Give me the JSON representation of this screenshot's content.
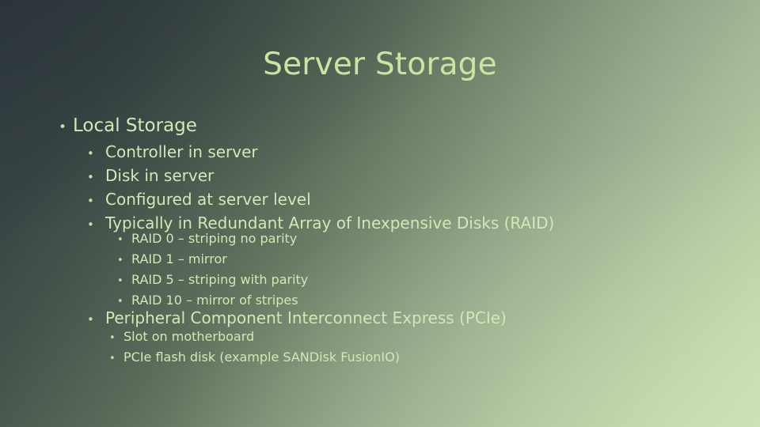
{
  "slide": {
    "title": "Server Storage",
    "title_color": "#c9e6a1",
    "body_color": "#d2e8b6",
    "background": {
      "top_left_color": "#333d44",
      "top_right_color": "#9ab190",
      "bottom_left_color": "#414d45",
      "bottom_right_color": "#c3dcac",
      "center_color": "#8fa289",
      "direction": "diagonal-top-left-dark-to-bottom-right-light"
    },
    "bullet_glyph": "•",
    "groups": [
      {
        "level": 1,
        "items": [
          {
            "text": "Local Storage"
          }
        ]
      },
      {
        "level": 2,
        "items": [
          {
            "text": "Controller in server"
          },
          {
            "text": "Disk in server"
          },
          {
            "text": "Configured at server level"
          },
          {
            "text": "Typically in Redundant Array of Inexpensive Disks (RAID)"
          }
        ]
      },
      {
        "level": 3,
        "items": [
          {
            "text": "RAID 0 – striping no parity"
          },
          {
            "text": "RAID 1 – mirror"
          },
          {
            "text": "RAID 5 – striping with parity"
          },
          {
            "text": "RAID 10 – mirror of stripes"
          }
        ]
      },
      {
        "level": 2,
        "items": [
          {
            "text": "Peripheral Component Interconnect Express (PCIe)"
          }
        ]
      },
      {
        "level": 3,
        "items": [
          {
            "text": "Slot on motherboard"
          },
          {
            "text": "PCIe flash disk (example SANDisk FusionIO)"
          }
        ]
      }
    ]
  }
}
